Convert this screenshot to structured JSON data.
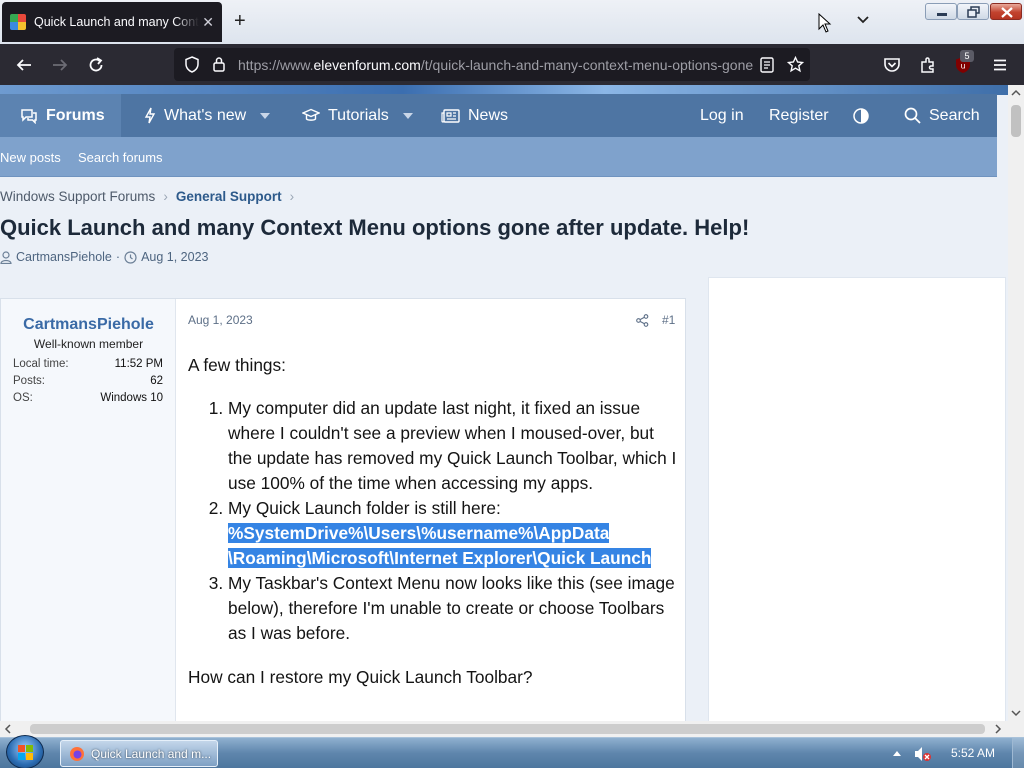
{
  "browser": {
    "tab_title": "Quick Launch and many Conte",
    "url_prefix": "https://www.",
    "url_domain": "elevenforum.com",
    "url_path": "/t/quick-launch-and-many-context-menu-options-gone",
    "extension_badge": "5"
  },
  "forum_nav": {
    "forums": "Forums",
    "whats_new": "What's new",
    "tutorials": "Tutorials",
    "news": "News",
    "login": "Log in",
    "register": "Register",
    "search": "Search"
  },
  "sub_nav": {
    "new_posts": "New posts",
    "search_forums": "Search forums"
  },
  "breadcrumb": {
    "root": "Windows Support Forums",
    "current": "General Support"
  },
  "thread": {
    "title": "Quick Launch and many Context Menu options gone after update. Help!",
    "author": "CartmansPiehole",
    "date": "Aug 1, 2023"
  },
  "post": {
    "username": "CartmansPiehole",
    "user_title": "Well-known member",
    "local_time_label": "Local time:",
    "local_time": "11:52 PM",
    "posts_label": "Posts:",
    "posts": "62",
    "os_label": "OS:",
    "os": "Windows 10",
    "date": "Aug 1, 2023",
    "number": "#1",
    "intro": "A few things:",
    "item1": "My computer did an update last night, it fixed an issue where I couldn't see a preview when I moused-over, but the update has removed my Quick Launch Toolbar, which I use 100% of the time when accessing my apps.",
    "item2": "My Quick Launch folder is still here:",
    "item2_path_line1": "%SystemDrive%\\Users\\%username%\\AppData",
    "item2_path_line2": "\\Roaming\\Microsoft\\Internet Explorer\\Quick Launch",
    "item3": "My Taskbar's Context Menu now looks like this (see image below), therefore I'm unable to create or choose Toolbars as I was before.",
    "question": "How can I restore my Quick Launch Toolbar?"
  },
  "taskbar": {
    "task_label": "Quick Launch and m...",
    "clock": "5:52 AM"
  },
  "colors": {
    "nav_bar": "#4e75a3",
    "sub_nav": "#7fa2cc",
    "highlight": "#3584e4",
    "username": "#3a6aa6"
  }
}
